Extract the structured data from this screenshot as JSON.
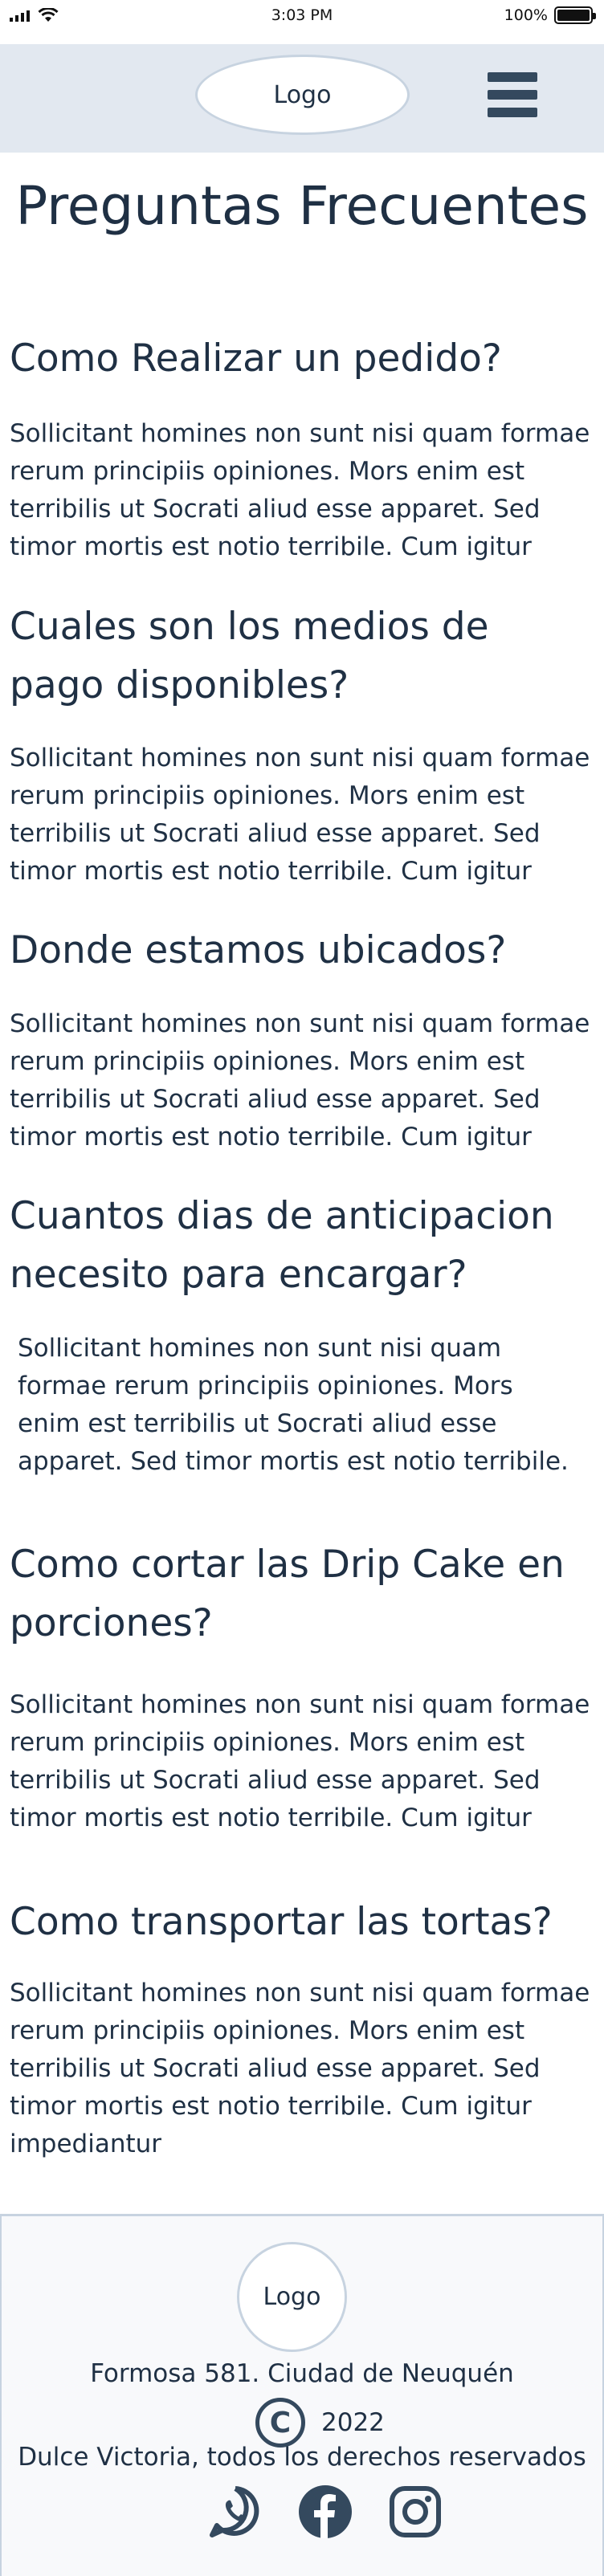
{
  "status_bar": {
    "time": "3:03 PM",
    "battery": "100%",
    "icons": [
      "signal-icon",
      "wifi-icon",
      "battery-icon"
    ]
  },
  "header": {
    "logo": "Logo",
    "menu_icon": "hamburger-menu-icon"
  },
  "page_title": "Preguntas Frecuentes",
  "faq": [
    {
      "question": "Como Realizar un pedido?",
      "answer": "Sollicitant homines non sunt nisi quam formae rerum principiis opiniones. Mors enim est terribilis ut Socrati aliud esse apparet. Sed timor mortis est notio terribile. Cum igitur"
    },
    {
      "question": "Cuales son los medios de pago disponibles?",
      "answer": "Sollicitant homines non sunt nisi quam formae rerum principiis opiniones. Mors enim est terribilis ut Socrati aliud esse apparet. Sed timor mortis est notio terribile. Cum igitur"
    },
    {
      "question": "Donde estamos ubicados?",
      "answer": "Sollicitant homines non sunt nisi quam formae rerum principiis opiniones. Mors enim est terribilis ut Socrati aliud esse apparet. Sed timor mortis est notio terribile. Cum igitur"
    },
    {
      "question": "Cuantos dias de anticipacion necesito para encargar?",
      "answer": "Sollicitant homines non sunt nisi quam formae rerum principiis opiniones. Mors enim est terribilis ut Socrati aliud esse apparet. Sed timor mortis est notio terribile."
    },
    {
      "question": "Como cortar las Drip Cake en porciones?",
      "answer": "Sollicitant homines non sunt nisi quam formae rerum principiis opiniones. Mors enim est terribilis ut Socrati aliud esse apparet. Sed timor mortis est notio terribile. Cum igitur"
    },
    {
      "question": "Como transportar las tortas?",
      "answer": "Sollicitant homines non sunt nisi quam formae rerum principiis opiniones. Mors enim est terribilis ut Socrati aliud esse apparet. Sed timor mortis est notio terribile. Cum igitur impediantur"
    }
  ],
  "footer": {
    "logo": "Logo",
    "address": "Formosa 581. Ciudad de Neuquén",
    "copyright_symbol": "C",
    "year": "2022",
    "rights": "Dulce Victoria, todos los derechos reservados",
    "social_icons": [
      "whatsapp-icon",
      "facebook-icon",
      "instagram-icon"
    ]
  },
  "colors": {
    "header_bg": "#e2e8f0",
    "text": "#1f3044",
    "icon": "#34495e",
    "border": "#c7d3e0"
  }
}
